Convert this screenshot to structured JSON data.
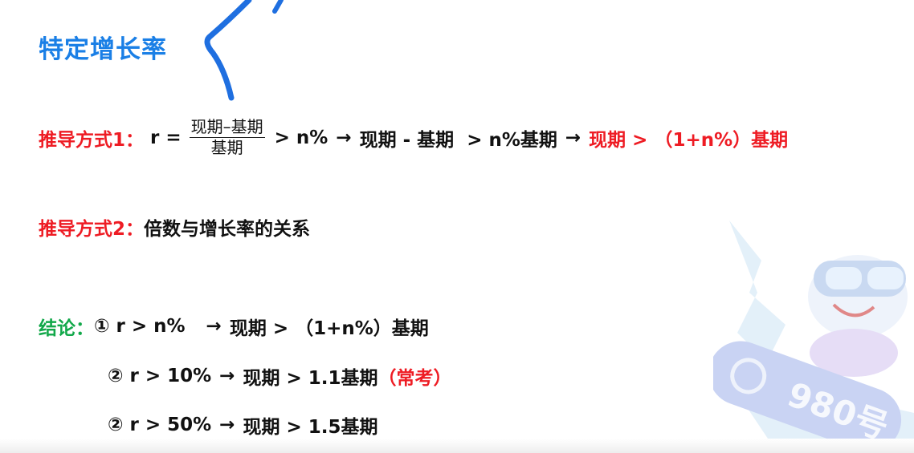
{
  "title": "特定增长率",
  "method1": {
    "label": "推导方式1：",
    "r_eq": "r =",
    "frac_num": "现期–基期",
    "frac_den": "基期",
    "gt_n": "> n%",
    "arrow1": "→",
    "diff": "现期 - 基期",
    "gt_nbase": "> n%基期",
    "arrow2": "→",
    "result": "现期 > （1+n%）基期"
  },
  "method2": {
    "label": "推导方式2：",
    "text": "倍数与增长率的关系"
  },
  "conclusion": {
    "label": "结论：",
    "items": [
      {
        "marker": "①",
        "cond": "r > n%",
        "arrow": "→",
        "res": "现期 > （1+n%）基期",
        "note": ""
      },
      {
        "marker": "②",
        "cond": "r > 10%",
        "arrow": "→",
        "res": "现期 > 1.1基期",
        "note": "（常考）"
      },
      {
        "marker": "②",
        "cond": "r > 50%",
        "arrow": "→",
        "res": "现期 > 1.5基期",
        "note": ""
      }
    ]
  },
  "mascot_badge": "980号",
  "colors": {
    "title": "#1a7fe6",
    "label_red": "#ee1c24",
    "label_green": "#12a84a"
  }
}
